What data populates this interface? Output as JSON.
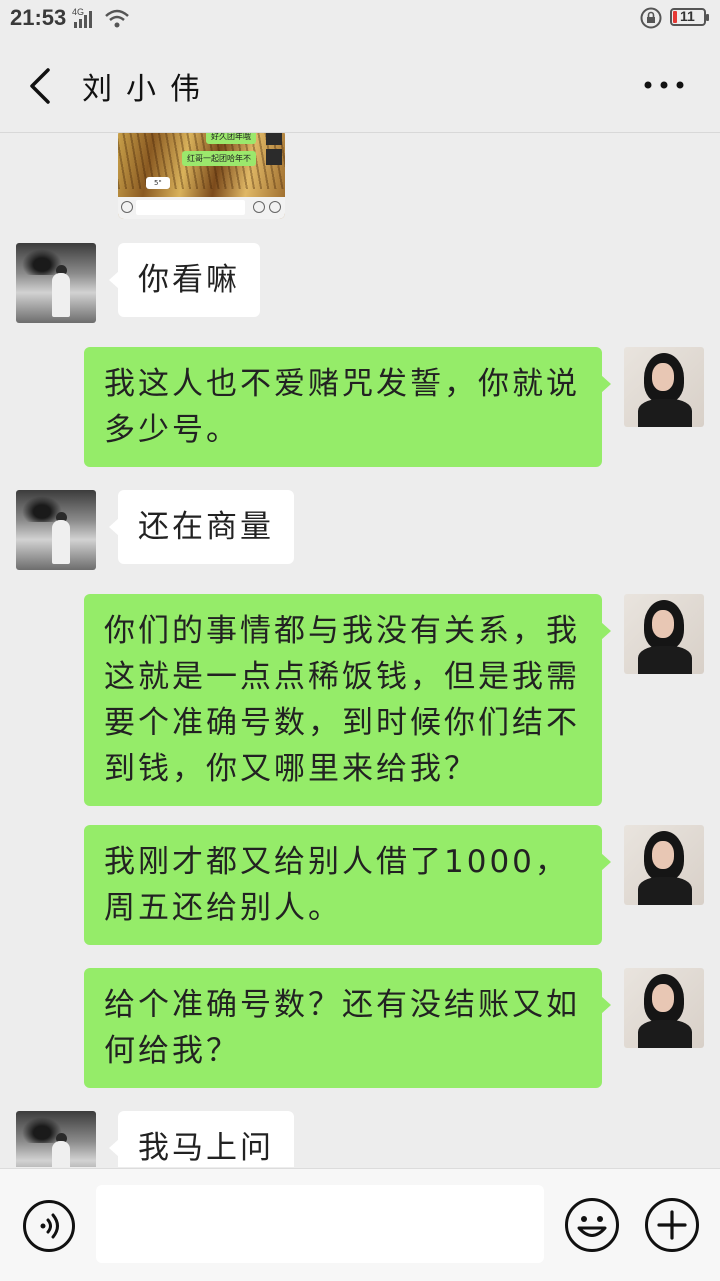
{
  "status": {
    "time": "21:53",
    "network": "4G",
    "battery": "11",
    "battery_color": "#e53935"
  },
  "header": {
    "title": "刘小伟",
    "back_icon": "chevron-left-icon",
    "more_icon": "more-dots-icon"
  },
  "shared_screenshot": {
    "bubble_1": "好久团年哦",
    "bubble_2": "红哥一起团哈年不",
    "voice_length": "5\""
  },
  "messages": [
    {
      "side": "left",
      "text": "你看嘛"
    },
    {
      "side": "right",
      "text": "我这人也不爱赌咒发誓，你就说多少号。"
    },
    {
      "side": "left",
      "text": "还在商量"
    },
    {
      "side": "right",
      "text": "你们的事情都与我没有关系，我这就是一点点稀饭钱，但是我需要个准确号数，到时候你们结不到钱，你又哪里来给我？"
    },
    {
      "side": "right",
      "text": "我刚才都又给别人借了1000，周五还给别人。"
    },
    {
      "side": "right",
      "text": "给个准确号数？还有没结账又如何给我？"
    },
    {
      "side": "left",
      "text": "我马上问"
    }
  ],
  "input": {
    "value": "",
    "voice_icon": "voice-icon",
    "emoji_icon": "emoji-icon",
    "plus_icon": "plus-icon"
  },
  "colors": {
    "background": "#ededed",
    "sent_bubble": "#95ec69",
    "received_bubble": "#ffffff"
  }
}
